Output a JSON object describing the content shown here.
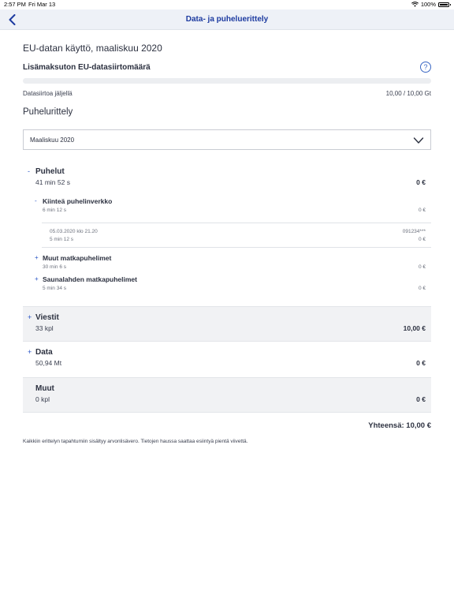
{
  "status_bar": {
    "time": "2:57 PM",
    "date": "Fri Mar 13",
    "battery": "100%"
  },
  "nav": {
    "title": "Data- ja puheluerittely"
  },
  "eu": {
    "heading": "EU-datan käyttö, maaliskuu 2020",
    "subheading": "Lisämaksuton EU-datasiirtomäärä",
    "help_symbol": "?",
    "remaining_label": "Datasiirtoa jäljellä",
    "remaining_value": "10,00 / 10,00 Gt",
    "used_fraction": 0.0
  },
  "breakdown": {
    "title": "Puhelurittely",
    "month_selected": "Maaliskuu 2020"
  },
  "groups": {
    "calls": {
      "toggle": "-",
      "name": "Puhelut",
      "meta": "41 min 52 s",
      "amount": "0 €",
      "landline": {
        "toggle": "-",
        "name": "Kiinteä puhelinverkko",
        "meta": "6 min 12 s",
        "amount": "0 €"
      },
      "call_entry": {
        "datetime": "05.03.2020 klo 21.20",
        "number": "091234***",
        "duration": "5 min 12 s",
        "amount": "0 €"
      },
      "other_mobile": {
        "toggle": "+",
        "name": "Muut matkapuhelimet",
        "meta": "30 min 6 s",
        "amount": "0 €"
      },
      "saunalahti_mobile": {
        "toggle": "+",
        "name": "Saunalahden matkapuhelimet",
        "meta": "5 min 34 s",
        "amount": "0 €"
      }
    },
    "messages": {
      "toggle": "+",
      "name": "Viestit",
      "meta": "33 kpl",
      "amount": "10,00 €"
    },
    "data": {
      "toggle": "+",
      "name": "Data",
      "meta": "50,94 Mt",
      "amount": "0 €"
    },
    "other": {
      "name": "Muut",
      "meta": "0 kpl",
      "amount": "0 €"
    }
  },
  "total": "Yhteensä: 10,00 €",
  "footnote": "Kaikkiin erittelyn tapahtumiin sisältyy arvonlisävero. Tietojen haussa saattaa esiintyä pientä viivettä.",
  "colors": {
    "accent": "#1c3aa0",
    "link": "#2a56c6",
    "nav_bg": "#eef1f7",
    "row_grey": "#f1f2f4"
  },
  "icons": {
    "back": "chevron-left-icon",
    "select": "chevron-down-icon",
    "help": "question-circle-icon",
    "wifi": "wifi-icon",
    "battery": "battery-icon"
  }
}
